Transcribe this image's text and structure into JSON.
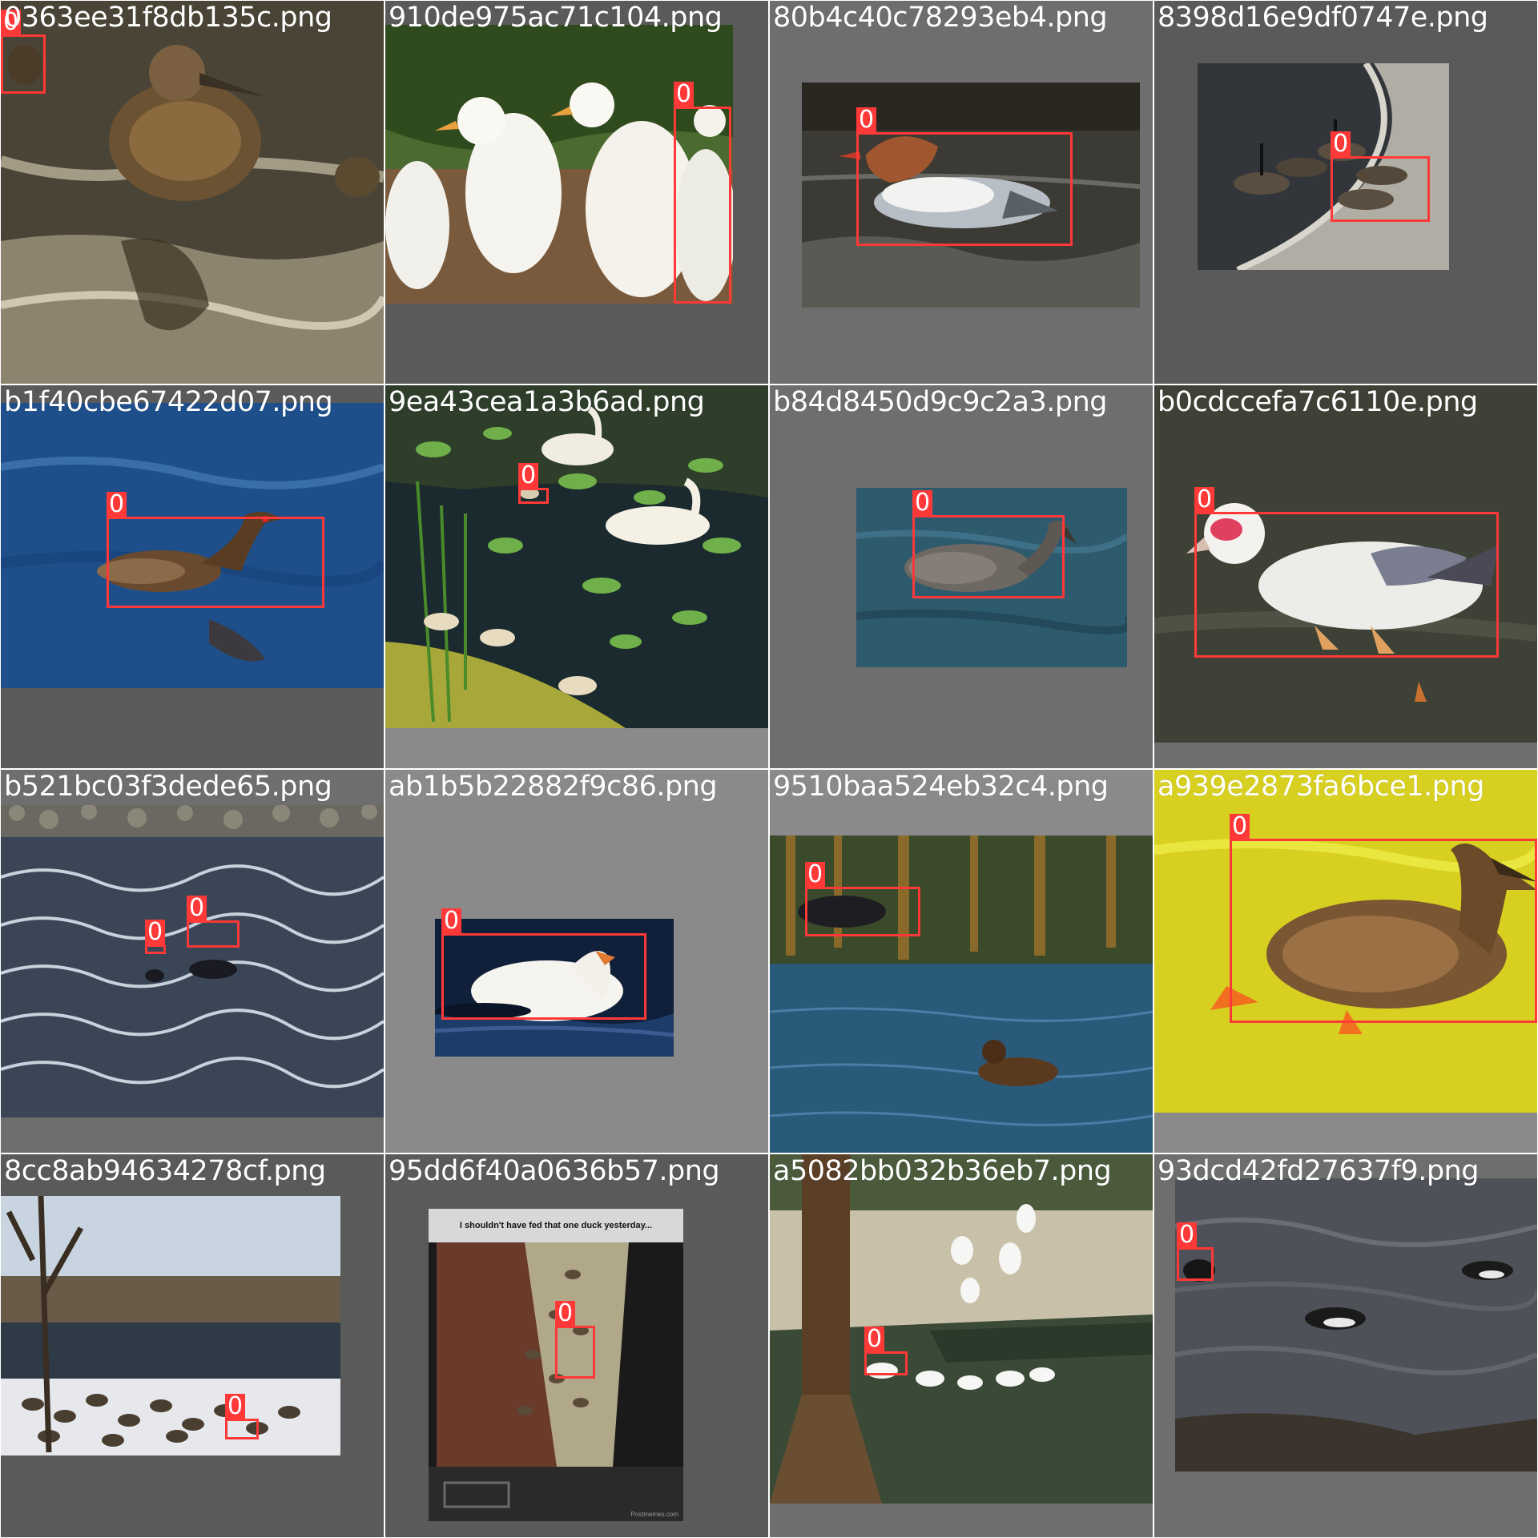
{
  "mosaic": {
    "label_class": "0",
    "box_color": "#ff3838",
    "tiles": [
      {
        "file": "0363ee31f8db135c.png",
        "labels": [
          "0"
        ]
      },
      {
        "file": "910de975ac71c104.png",
        "labels": [
          "0"
        ]
      },
      {
        "file": "80b4c40c78293eb4.png",
        "labels": [
          "0"
        ]
      },
      {
        "file": "8398d16e9df0747e.png",
        "labels": [
          "0"
        ]
      },
      {
        "file": "b1f40cbe67422d07.png",
        "labels": [
          "0"
        ]
      },
      {
        "file": "9ea43cea1a3b6ad.png",
        "labels": [
          "0"
        ]
      },
      {
        "file": "b84d8450d9c9c2a3.png",
        "labels": [
          "0"
        ]
      },
      {
        "file": "b0cdccefa7c6110e.png",
        "labels": [
          "0"
        ]
      },
      {
        "file": "b521bc03f3dede65.png",
        "labels": [
          "0",
          "0"
        ]
      },
      {
        "file": "ab1b5b22882f9c86.png",
        "labels": [
          "0"
        ]
      },
      {
        "file": "9510baa524eb32c4.png",
        "labels": [
          "0"
        ]
      },
      {
        "file": "a939e2873fa6bce1.png",
        "labels": [
          "0"
        ]
      },
      {
        "file": "8cc8ab94634278cf.png",
        "labels": [
          "0"
        ]
      },
      {
        "file": "95dd6f40a0636b57.png",
        "labels": [
          "0"
        ],
        "caption": "I shouldn't have fed that one duck yesterday...",
        "watermark": "Postmemes.com"
      },
      {
        "file": "a5082bb032b36eb7.png",
        "labels": [
          "0"
        ]
      },
      {
        "file": "93dcd42fd27637f9.png",
        "labels": [
          "0"
        ]
      }
    ]
  }
}
